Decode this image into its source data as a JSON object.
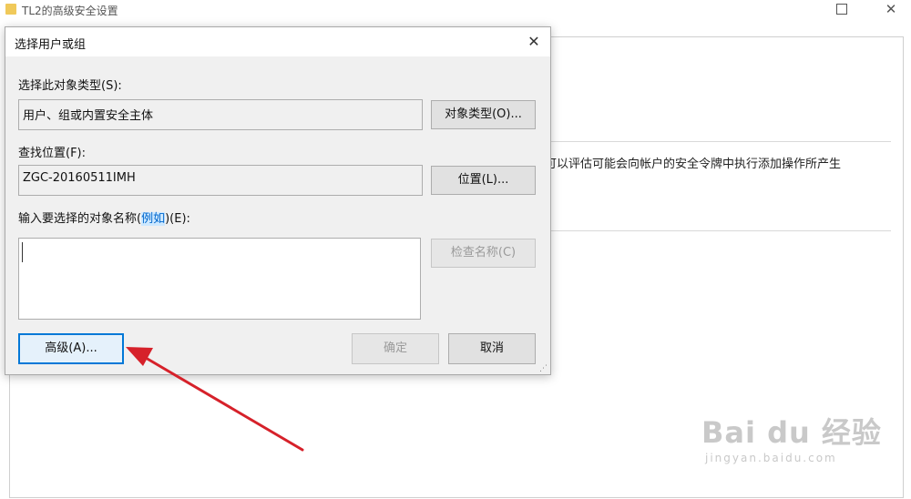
{
  "background_window": {
    "title": "TL2的高级安全设置",
    "close_glyph": "✕",
    "description": "可以评估可能会向帐户的安全令牌中执行添加操作所产生"
  },
  "dialog": {
    "title": "选择用户或组",
    "close_glyph": "✕",
    "object_types_label": "选择此对象类型(S):",
    "object_types_value": "用户、组或内置安全主体",
    "object_types_button": "对象类型(O)...",
    "location_label": "查找位置(F):",
    "location_value": "ZGC-20160511IMH",
    "location_button": "位置(L)...",
    "names_label_pre": "输入要选择的对象名称(",
    "names_label_link": "例如",
    "names_label_post": ")(E):",
    "names_value": "",
    "check_names_button": "检查名称(C)",
    "advanced_button": "高级(A)...",
    "ok_button": "确定",
    "cancel_button": "取消",
    "resize_grip": "⋰"
  },
  "watermark": {
    "text": "Bai du 经验",
    "sub": "jingyan.baidu.com"
  },
  "colors": {
    "annotation_arrow": "#d6212a",
    "focus_border": "#0078d7"
  }
}
